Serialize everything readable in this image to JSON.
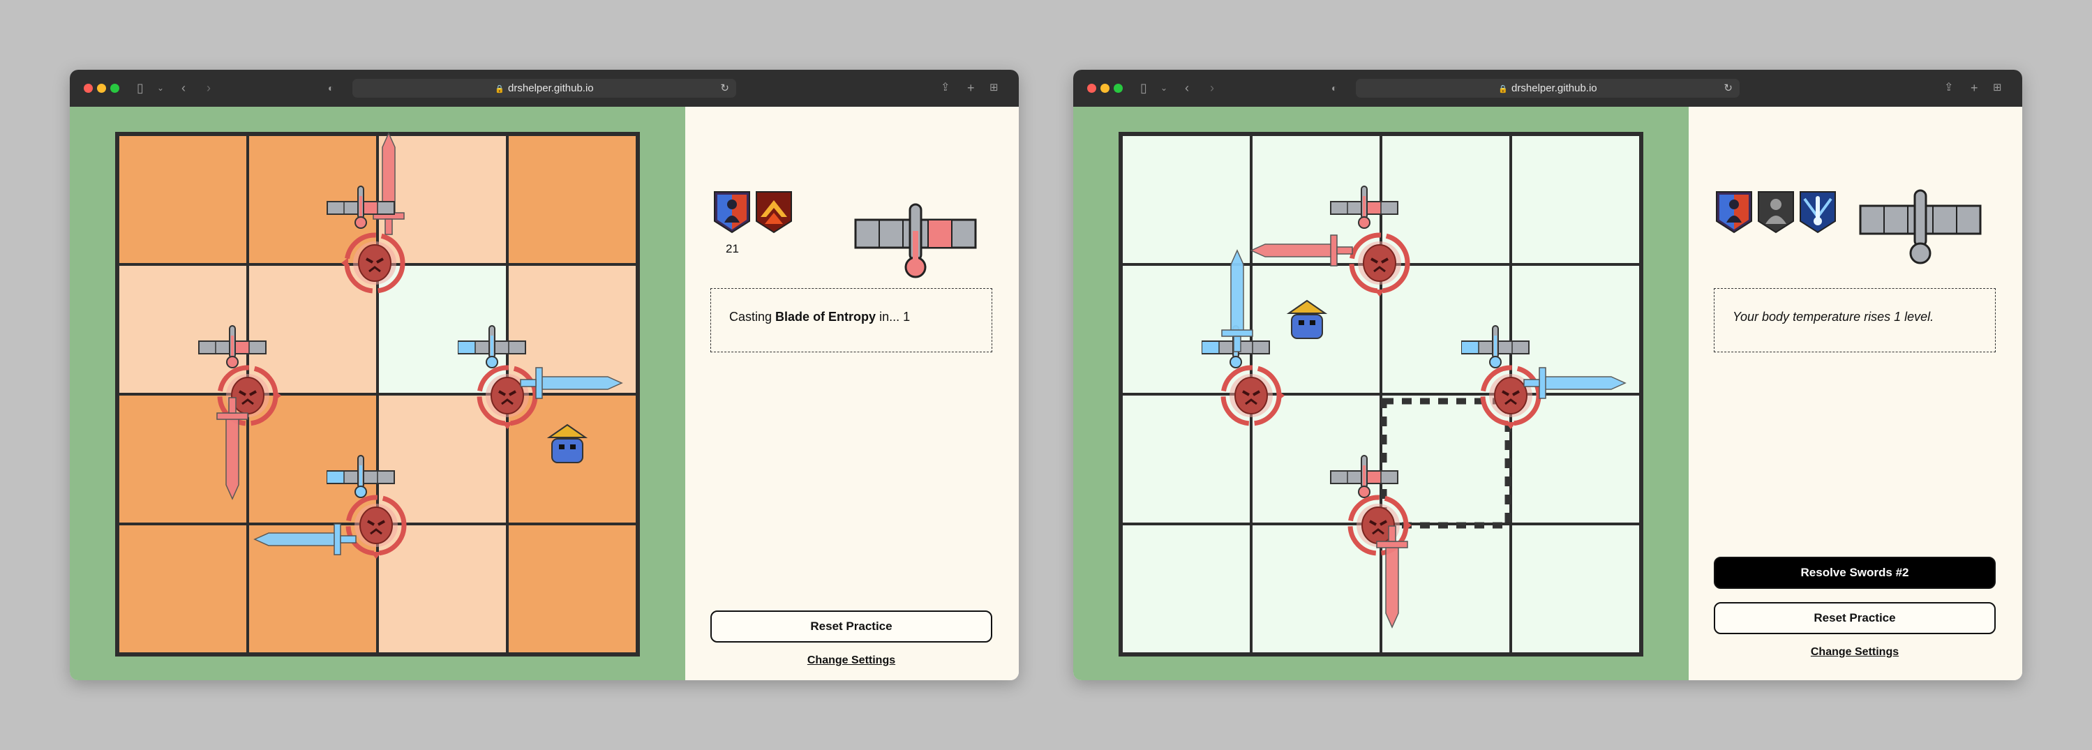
{
  "browser": {
    "url": "drshelper.github.io"
  },
  "colors": {
    "board_bg": "#8fbc8b",
    "panel_bg": "#fdf9ee",
    "hot_cell": "#f2a563",
    "warm_cell": "#fad2b0",
    "cool_cell": "#eefbef",
    "red_sword": "#f08080",
    "blue_sword": "#87cefa",
    "boss_marker": "#d9534f"
  },
  "left_window": {
    "status_icons": [
      "fire-ice-debuff-icon",
      "fire-aura-icon"
    ],
    "counter": "21",
    "thermometer_fill_level": 3,
    "status": {
      "prefix": "Casting ",
      "spell": "Blade of Entropy",
      "suffix": " in... 1"
    },
    "reset_label": "Reset Practice",
    "settings_label": "Change Settings"
  },
  "right_window": {
    "status_icons": [
      "fire-ice-debuff-icon",
      "shadow-debuff-icon",
      "cold-aura-icon"
    ],
    "thermometer_fill_level": 0,
    "status_text": "Your body temperature rises 1 level.",
    "resolve_label": "Resolve Swords #2",
    "reset_label": "Reset Practice",
    "settings_label": "Change Settings"
  }
}
